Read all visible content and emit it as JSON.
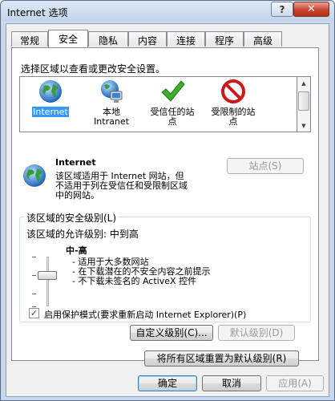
{
  "window": {
    "title": "Internet 选项",
    "help_label": "?",
    "close_label": "✕"
  },
  "tabs": [
    {
      "label": "常规"
    },
    {
      "label": "安全"
    },
    {
      "label": "隐私"
    },
    {
      "label": "内容"
    },
    {
      "label": "连接"
    },
    {
      "label": "程序"
    },
    {
      "label": "高级"
    }
  ],
  "security": {
    "select_zone_prompt": "选择区域以查看或更改安全设置。",
    "zones": [
      {
        "label": "Internet",
        "icon": "globe-icon"
      },
      {
        "label": "本地\nIntranet",
        "icon": "intranet-icon"
      },
      {
        "label": "受信任的站\n点",
        "icon": "checkmark-icon"
      },
      {
        "label": "受限制的站\n点",
        "icon": "restricted-icon"
      }
    ],
    "selected_zone_title": "Internet",
    "selected_zone_desc": "该区域适用于 Internet 网站，但\n不适用于列在受信任和受限制区域\n中的网站。",
    "sites_button": "站点(S)",
    "level_group_title": "该区域的安全级别(L)",
    "allowed_levels": "该区域的允许级别: 中到高",
    "level_name": "中-高",
    "level_bullets": [
      "- 适用于大多数网站",
      "- 在下载潜在的不安全内容之前提示",
      "- 不下载未签名的 ActiveX 控件"
    ],
    "protected_mode_checked": true,
    "protected_mode_label": "启用保护模式(要求重新启动 Internet Explorer)(P)",
    "custom_level_button": "自定义级别(C)...",
    "default_level_button": "默认级别(D)",
    "reset_all_button": "将所有区域重置为默认级别(R)"
  },
  "footer": {
    "ok_button": "确定",
    "cancel_button": "取消",
    "apply_button": "应用(A)"
  },
  "colors": {
    "selection": "#3399ff",
    "title_bar": "#c3d4ea",
    "close_button": "#c7452e"
  }
}
